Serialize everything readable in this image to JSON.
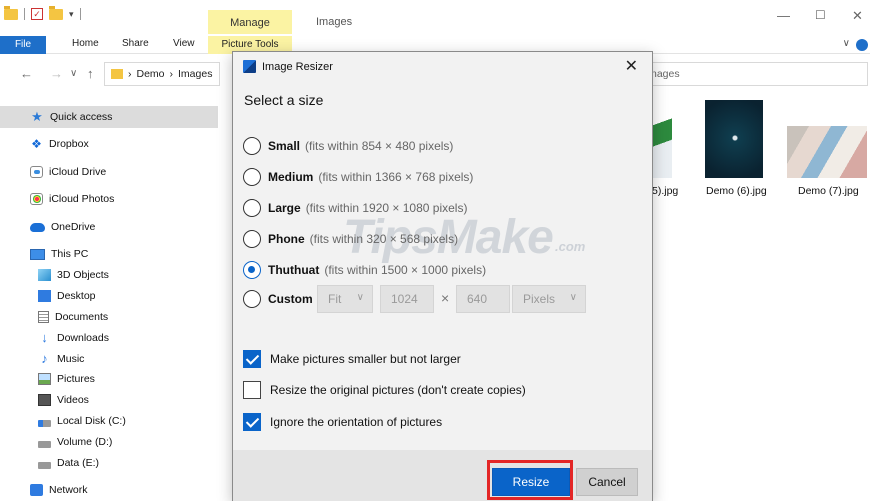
{
  "explorer": {
    "manage_tab": "Manage",
    "window_title": "Images",
    "ribbon_tabs": [
      "File",
      "Home",
      "Share",
      "View",
      "Picture Tools"
    ],
    "address_path": [
      "Demo",
      "Images"
    ],
    "search_text": "nages",
    "sidebar": [
      {
        "label": "Quick access",
        "icon": "star-icon"
      },
      {
        "label": "Dropbox",
        "icon": "dropbox-icon"
      },
      {
        "label": "iCloud Drive",
        "icon": "icloud-drive-icon"
      },
      {
        "label": "iCloud Photos",
        "icon": "icloud-photos-icon"
      },
      {
        "label": "OneDrive",
        "icon": "onedrive-icon"
      },
      {
        "label": "This PC",
        "icon": "this-pc-icon"
      },
      {
        "label": "3D Objects",
        "icon": "3d-objects-icon"
      },
      {
        "label": "Desktop",
        "icon": "desktop-icon"
      },
      {
        "label": "Documents",
        "icon": "documents-icon"
      },
      {
        "label": "Downloads",
        "icon": "downloads-icon"
      },
      {
        "label": "Music",
        "icon": "music-icon"
      },
      {
        "label": "Pictures",
        "icon": "pictures-icon"
      },
      {
        "label": "Videos",
        "icon": "videos-icon"
      },
      {
        "label": "Local Disk (C:)",
        "icon": "local-disk-icon"
      },
      {
        "label": "Volume (D:)",
        "icon": "drive-icon"
      },
      {
        "label": "Data (E:)",
        "icon": "drive-icon"
      },
      {
        "label": "Network",
        "icon": "network-icon"
      }
    ],
    "files": [
      "5).jpg",
      "Demo (6).jpg",
      "Demo (7).jpg"
    ]
  },
  "dialog": {
    "title": "Image Resizer",
    "heading": "Select a size",
    "sizes": [
      {
        "name": "Small",
        "desc": "(fits within 854 × 480 pixels)",
        "selected": false
      },
      {
        "name": "Medium",
        "desc": "(fits within 1366 × 768 pixels)",
        "selected": false
      },
      {
        "name": "Large",
        "desc": "(fits within 1920 × 1080 pixels)",
        "selected": false
      },
      {
        "name": "Phone",
        "desc": "(fits within 320 × 568 pixels)",
        "selected": false
      },
      {
        "name": "Thuthuat",
        "desc": "(fits within 1500 × 1000 pixels)",
        "selected": true
      }
    ],
    "custom": {
      "name": "Custom",
      "fit": "Fit",
      "width": "1024",
      "times": "×",
      "height": "640",
      "unit": "Pixels"
    },
    "options": [
      {
        "label": "Make pictures smaller but not larger",
        "checked": true
      },
      {
        "label": "Resize the original pictures (don't create copies)",
        "checked": false
      },
      {
        "label": "Ignore the orientation of pictures",
        "checked": true
      }
    ],
    "buttons": {
      "resize": "Resize",
      "cancel": "Cancel"
    }
  },
  "watermark": {
    "main": "TipsMake",
    "sub": ".com"
  },
  "colors": {
    "accent": "#0a64c9",
    "highlight": "#e32626",
    "manage_tab": "#fbf3a3"
  }
}
